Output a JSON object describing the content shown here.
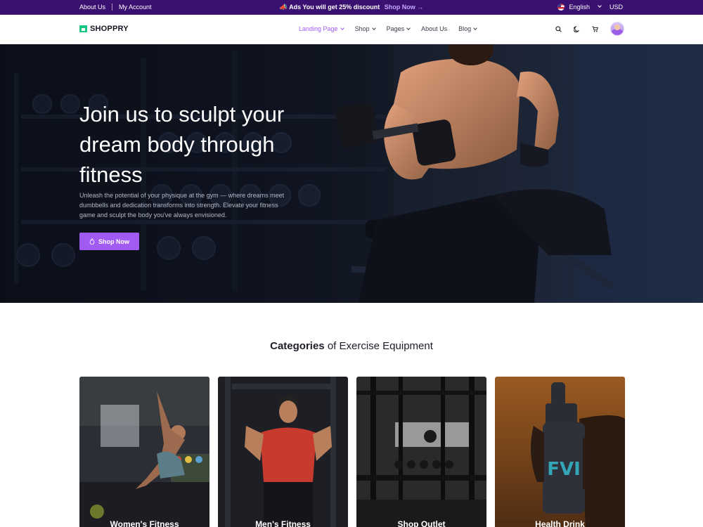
{
  "topbar": {
    "left_links": [
      "About Us",
      "My Account"
    ],
    "promo_text": "Ads You will get 25% discount",
    "promo_link": "Shop Now →",
    "language": "English",
    "currency": "USD"
  },
  "header": {
    "brand": "SHOPPRY",
    "nav": [
      {
        "label": "Landing Page",
        "has_dropdown": true,
        "active": true
      },
      {
        "label": "Shop",
        "has_dropdown": true
      },
      {
        "label": "Pages",
        "has_dropdown": true
      },
      {
        "label": "About Us",
        "has_dropdown": false
      },
      {
        "label": "Blog",
        "has_dropdown": true
      }
    ],
    "icons": [
      "search-icon",
      "moon-icon",
      "cart-icon",
      "avatar"
    ]
  },
  "hero": {
    "title": "Join us to sculpt your dream body through fitness",
    "text": "Unleash the potential of your physique at the gym — where dreams meet dumbbells and dedication transforms into strength. Elevate your fitness game and sculpt the body you've always envisioned.",
    "cta": "Shop Now"
  },
  "categories": {
    "heading_bold": "Categories",
    "heading_rest": "of Exercise Equipment",
    "items": [
      {
        "label": "Women's Fitness"
      },
      {
        "label": "Men's Fitness"
      },
      {
        "label": "Shop Outlet"
      },
      {
        "label": "Health Drink"
      }
    ]
  },
  "colors": {
    "topbar_bg": "#3a1070",
    "accent": "#a25bf2",
    "brand_green": "#16c784"
  }
}
